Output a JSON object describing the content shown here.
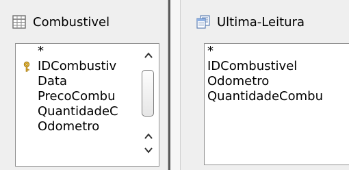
{
  "tables": [
    {
      "title": "Combustivel",
      "icon": "table-icon",
      "fields": [
        {
          "label": "*",
          "primary_key": false
        },
        {
          "label": "IDCombustiv",
          "primary_key": true
        },
        {
          "label": "Data",
          "primary_key": false
        },
        {
          "label": "PrecoCombu",
          "primary_key": false
        },
        {
          "label": "QuantidadeC",
          "primary_key": false
        },
        {
          "label": "Odometro",
          "primary_key": false
        }
      ]
    },
    {
      "title": "Ultima-Leitura",
      "icon": "query-icon",
      "fields": [
        {
          "label": "*"
        },
        {
          "label": "IDCombustivel"
        },
        {
          "label": "Odometro"
        },
        {
          "label": "QuantidadeCombu"
        }
      ]
    }
  ]
}
